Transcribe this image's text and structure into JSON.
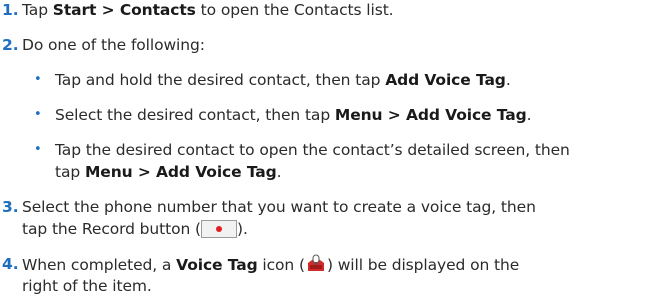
{
  "steps": {
    "s1": {
      "num": "1.",
      "a": "Tap ",
      "b": "Start > Contacts",
      "c": " to open the Contacts list."
    },
    "s2": {
      "num": "2.",
      "text": "Do one of the following:"
    },
    "b1": {
      "bullet": "•",
      "a": "Tap and hold the desired contact, then tap ",
      "b": "Add Voice Tag",
      "c": "."
    },
    "b2": {
      "bullet": "•",
      "a": "Select the desired contact, then tap ",
      "b": "Menu > Add Voice Tag",
      "c": "."
    },
    "b3": {
      "bullet": "•",
      "line1": "Tap the desired contact to open the contact’s detailed screen, then",
      "l2a": "tap ",
      "l2b": "Menu > Add Voice Tag",
      "l2c": "."
    },
    "s3": {
      "num": "3.",
      "line1": "Select the phone number that you want to create a voice tag, then",
      "l2a": "tap the Record button (",
      "l2c": ")."
    },
    "s4": {
      "num": "4.",
      "a": "When completed, a ",
      "b": "Voice Tag",
      "c": " icon (",
      "d": ") will be displayed on the",
      "line2": "right of the item."
    }
  },
  "icons": {
    "record": "record-button-icon",
    "voice_tag": "voice-tag-icon"
  },
  "colors": {
    "number": "#1f6fc1",
    "record_dot": "#e41f1f"
  }
}
